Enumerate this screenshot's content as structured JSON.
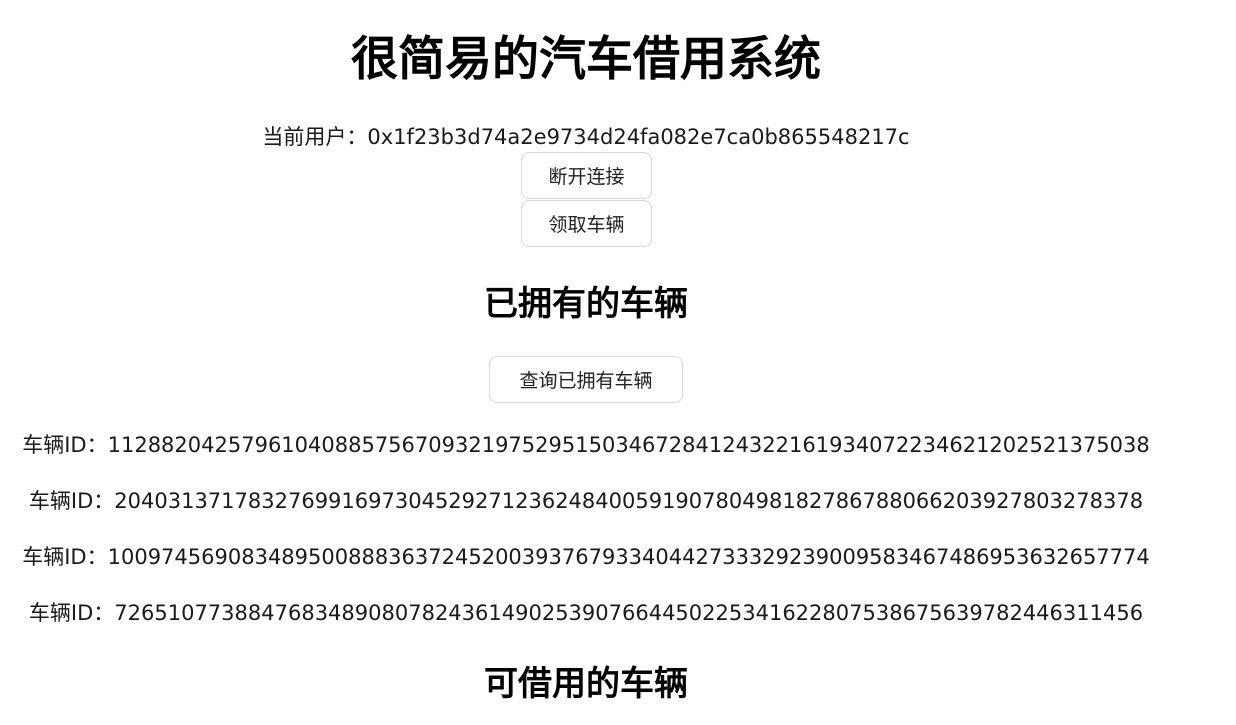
{
  "header": {
    "title": "很简易的汽车借用系统"
  },
  "account": {
    "label": "当前用户：",
    "address": "0x1f23b3d74a2e9734d24fa082e7ca0b865548217c"
  },
  "actions": {
    "disconnect_label": "断开连接",
    "claim_label": "领取车辆"
  },
  "owned": {
    "heading": "已拥有的车辆",
    "query_label": "查询已拥有车辆",
    "id_label": "车辆ID：",
    "vehicles": [
      "112882042579610408857567093219752951503467284124322161934072234621202521375038",
      "20403137178327699169730452927123624840059190780498182786788066203927803278378",
      "100974569083489500888363724520039376793340442733329239009583467486953632657774",
      "72651077388476834890807824361490253907664450225341622807538675639782446311456"
    ]
  },
  "borrowable": {
    "heading": "可借用的车辆"
  }
}
